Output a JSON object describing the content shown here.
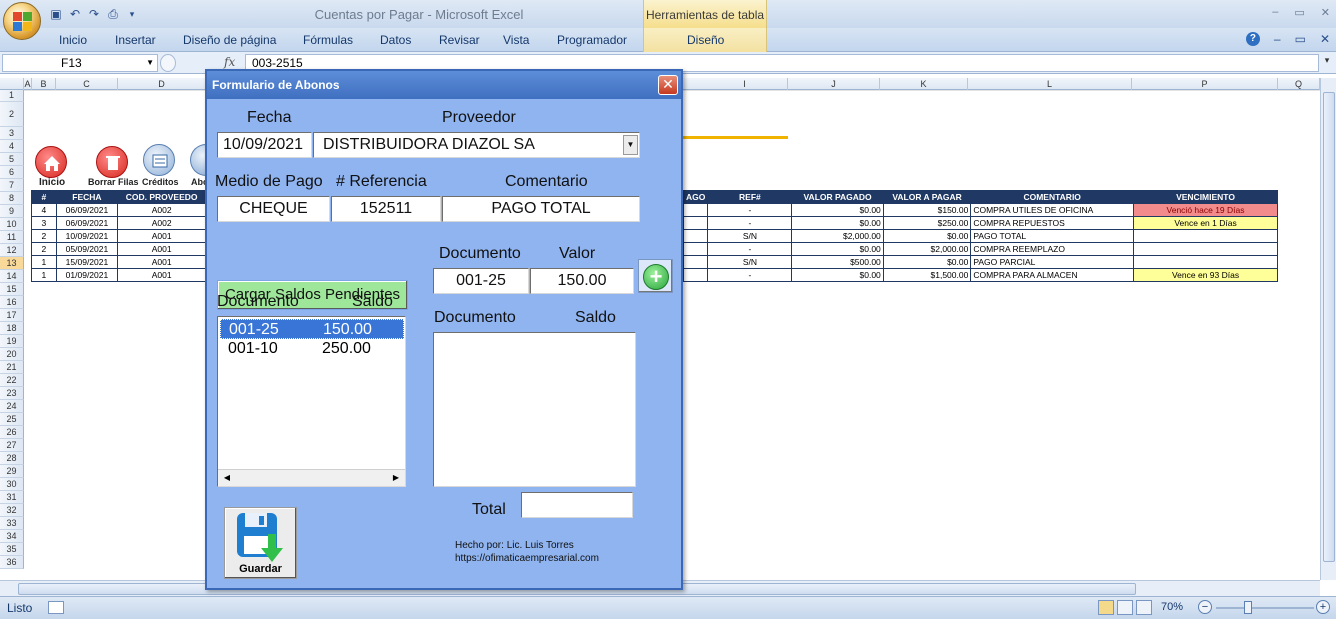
{
  "window": {
    "title": "Cuentas por Pagar - Microsoft Excel",
    "contextual_tab": "Herramientas de tabla",
    "controls": [
      "–",
      "▭",
      "✕"
    ]
  },
  "ribbon": {
    "tabs": [
      "Inicio",
      "Insertar",
      "Diseño de página",
      "Fórmulas",
      "Datos",
      "Revisar",
      "Vista",
      "Programador"
    ],
    "context_tab": "Diseño"
  },
  "formula_bar": {
    "name_box": "F13",
    "fx": "fx",
    "formula": "003-2515"
  },
  "columns": [
    "A",
    "B",
    "C",
    "D",
    "I",
    "J",
    "K",
    "L",
    "P",
    "Q"
  ],
  "rows": [
    "1",
    "2",
    "3",
    "4",
    "5",
    "6",
    "7",
    "8",
    "9",
    "10",
    "11",
    "12",
    "13",
    "14",
    "15",
    "16",
    "17",
    "18",
    "19",
    "20",
    "21",
    "22",
    "23",
    "24",
    "25",
    "26",
    "27",
    "28",
    "29",
    "30",
    "31",
    "32",
    "33",
    "34",
    "35",
    "36"
  ],
  "sheet_buttons": {
    "inicio": "Inicio",
    "borrar": "Borrar Filas",
    "creditos": "Créditos",
    "abonos": "Abo"
  },
  "table_left": {
    "headers": [
      "#",
      "FECHA",
      "COD. PROVEEDO"
    ],
    "rows": [
      [
        "4",
        "06/09/2021",
        "A002"
      ],
      [
        "3",
        "06/09/2021",
        "A002"
      ],
      [
        "2",
        "10/09/2021",
        "A001"
      ],
      [
        "2",
        "05/09/2021",
        "A001"
      ],
      [
        "1",
        "15/09/2021",
        "A001"
      ],
      [
        "1",
        "01/09/2021",
        "A001"
      ]
    ]
  },
  "table_right": {
    "headers": [
      "AGO",
      "REF#",
      "VALOR PAGADO",
      "VALOR A PAGAR",
      "COMENTARIO",
      "VENCIMIENTO"
    ],
    "rows": [
      [
        "",
        "-",
        "$0.00",
        "$150.00",
        "COMPRA UTILES DE OFICINA",
        "Venció hace 19 Días"
      ],
      [
        "",
        "-",
        "$0.00",
        "$250.00",
        "COMPRA REPUESTOS",
        "Vence en 1 Días"
      ],
      [
        "",
        "S/N",
        "$2,000.00",
        "$0.00",
        "PAGO TOTAL",
        ""
      ],
      [
        "",
        "-",
        "$0.00",
        "$2,000.00",
        "COMPRA REEMPLAZO",
        ""
      ],
      [
        "",
        "S/N",
        "$500.00",
        "$0.00",
        "PAGO PARCIAL",
        ""
      ],
      [
        "",
        "-",
        "$0.00",
        "$1,500.00",
        "COMPRA PARA ALMACEN",
        "Vence en 93 Días"
      ]
    ],
    "venc_colors": [
      "#f28b8b",
      "#ffff99",
      "",
      "",
      "",
      "#ffff99"
    ]
  },
  "form": {
    "title": "Formulario de Abonos",
    "close": "✕",
    "fecha_label": "Fecha",
    "fecha_value": "10/09/2021",
    "proveedor_label": "Proveedor",
    "proveedor_value": "DISTRIBUIDORA DIAZOL SA",
    "medio_label": "Medio de Pago",
    "medio_value": "CHEQUE",
    "referencia_label": "# Referencia",
    "referencia_value": "152511",
    "comentario_label": "Comentario",
    "comentario_value": "PAGO TOTAL",
    "cargar_button": "Cargar Saldos Pendientes",
    "doc_label": "Documento",
    "valor_label": "Valor",
    "doc_value": "001-25",
    "valor_value": "150.00",
    "list1_doc_label": "Documento",
    "list1_saldo_label": "Saldo",
    "list1_items": [
      {
        "doc": "001-25",
        "saldo": "150.00"
      },
      {
        "doc": "001-10",
        "saldo": "250.00"
      }
    ],
    "list2_doc_label": "Documento",
    "list2_saldo_label": "Saldo",
    "total_label": "Total",
    "total_value": "",
    "save_label": "Guardar",
    "credit_line1": "Hecho por: Lic. Luis Torres",
    "credit_line2": "https://ofimaticaempresarial.com"
  },
  "status": {
    "ready": "Listo",
    "zoom": "70%"
  }
}
